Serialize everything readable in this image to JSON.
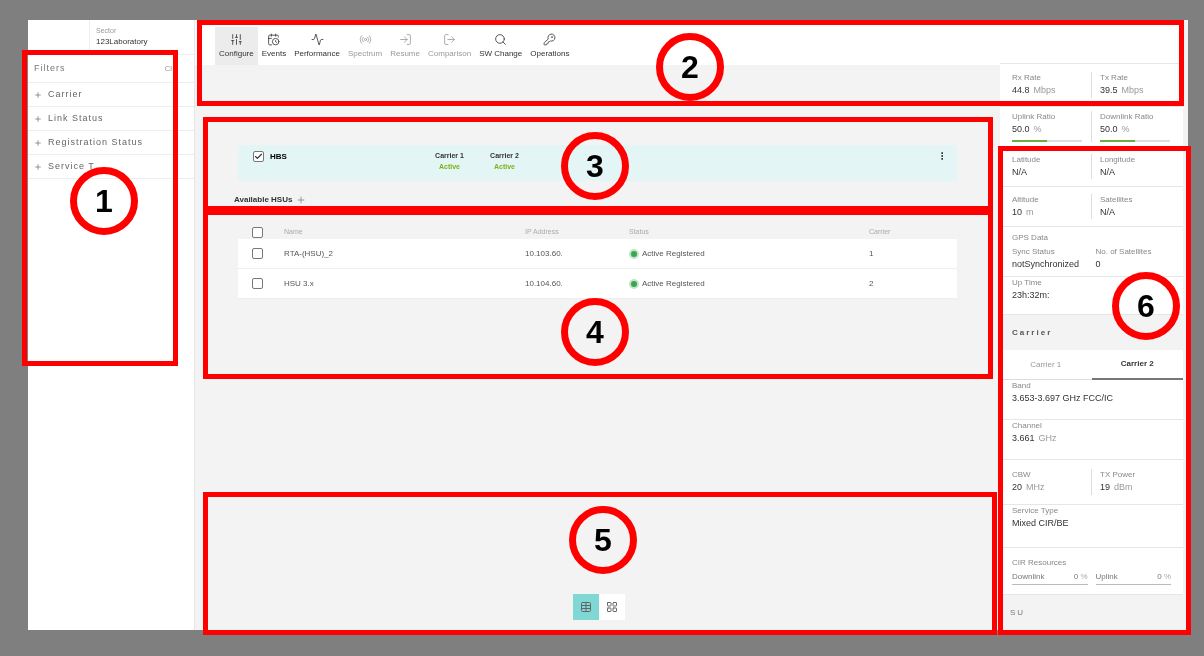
{
  "sector": {
    "label": "Sector",
    "value": "123Laboratory"
  },
  "filters": {
    "title": "Filters",
    "clear": "Cl",
    "items": [
      "Carrier",
      "Link Status",
      "Registration Status",
      "Service T"
    ]
  },
  "toolbar": [
    {
      "label": "Configure",
      "selected": true,
      "disabled": false
    },
    {
      "label": "Events",
      "selected": false,
      "disabled": false
    },
    {
      "label": "Performance",
      "selected": false,
      "disabled": false
    },
    {
      "label": "Spectrum",
      "selected": false,
      "disabled": true
    },
    {
      "label": "Resume",
      "selected": false,
      "disabled": true
    },
    {
      "label": "Comparison",
      "selected": false,
      "disabled": true
    },
    {
      "label": "SW Change",
      "selected": false,
      "disabled": false
    },
    {
      "label": "Operations",
      "selected": false,
      "disabled": false
    }
  ],
  "hbs": {
    "name": "HBS",
    "checked": true,
    "carriers": [
      {
        "label": "Carrier 1",
        "status": "Active"
      },
      {
        "label": "Carrier 2",
        "status": "Active"
      }
    ]
  },
  "hsus": {
    "title": "Available HSUs",
    "header_checked": false,
    "columns": [
      "Name",
      "IP Address",
      "Status",
      "Carrier"
    ],
    "rows": [
      {
        "checked": false,
        "name": "RTA-(HSU)_2",
        "ip": "10.103.60.",
        "status": "Active Registered",
        "carrier": "1"
      },
      {
        "checked": false,
        "name": "HSU 3.x",
        "ip": "10.104.60.",
        "status": "Active Registered",
        "carrier": "2"
      }
    ]
  },
  "view_toggle": [
    {
      "kind": "table",
      "selected": true
    },
    {
      "kind": "grid",
      "selected": false
    }
  ],
  "details": [
    {
      "kind": "pair",
      "items": [
        {
          "label": "Rx Rate",
          "value": "44.8",
          "unit": "Mbps"
        },
        {
          "label": "Tx Rate",
          "value": "39.5",
          "unit": "Mbps"
        }
      ]
    },
    {
      "kind": "ratio",
      "items": [
        {
          "label": "Uplink Ratio",
          "value": "50.0",
          "unit": "%",
          "level": 0.5
        },
        {
          "label": "Downlink Ratio",
          "value": "50.0",
          "unit": "%",
          "level": 0.5
        }
      ]
    },
    {
      "kind": "pair",
      "items": [
        {
          "label": "Latitude",
          "value": "N/A"
        },
        {
          "label": "Longitude",
          "value": "N/A"
        }
      ]
    },
    {
      "kind": "pair",
      "items": [
        {
          "label": "Altitude",
          "value": "10",
          "unit": "m"
        },
        {
          "label": "Satellites",
          "value": "N/A"
        }
      ]
    },
    {
      "kind": "gps",
      "title": "GPS Data",
      "items": [
        {
          "label": "Sync Status",
          "value": "notSynchronized"
        },
        {
          "label": "No. of Satellites",
          "value": "0"
        }
      ]
    },
    {
      "kind": "single",
      "items": [
        {
          "label": "Up Time",
          "value": "23h:32m:"
        }
      ]
    }
  ],
  "carrier": {
    "title": "Carrier",
    "tabs": [
      {
        "label": "Carrier 1",
        "selected": false
      },
      {
        "label": "Carrier 2",
        "selected": true
      }
    ],
    "fields": [
      {
        "kind": "single",
        "items": [
          {
            "label": "Band",
            "value": "3.653-3.697 GHz FCC/IC"
          }
        ]
      },
      {
        "kind": "single",
        "items": [
          {
            "label": "Channel",
            "value": "3.661",
            "unit": "GHz"
          }
        ]
      },
      {
        "kind": "pair",
        "items": [
          {
            "label": "CBW",
            "value": "20",
            "unit": "MHz"
          },
          {
            "label": "TX Power",
            "value": "19",
            "unit": "dBm"
          }
        ]
      },
      {
        "kind": "single",
        "items": [
          {
            "label": "Service Type",
            "value": "Mixed CIR/BE"
          }
        ]
      },
      {
        "kind": "cir",
        "title": "CIR Resources",
        "items": [
          {
            "label": "Downlink",
            "value": "0",
            "unit": "%"
          },
          {
            "label": "Uplink",
            "value": "0",
            "unit": "%"
          }
        ]
      }
    ]
  },
  "su": {
    "title": "SU"
  },
  "annotations": [
    {
      "label": "1"
    },
    {
      "label": "2"
    },
    {
      "label": "3"
    },
    {
      "label": "4"
    },
    {
      "label": "5"
    },
    {
      "label": "6"
    }
  ]
}
